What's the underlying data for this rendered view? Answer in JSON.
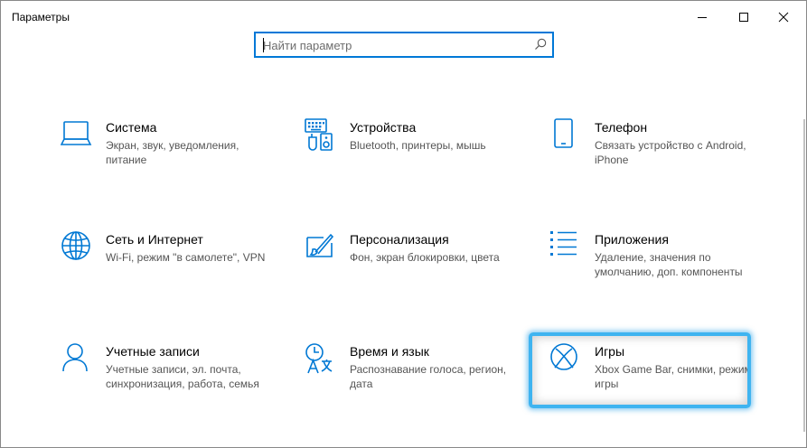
{
  "window": {
    "title": "Параметры"
  },
  "search": {
    "placeholder": "Найти параметр",
    "value": ""
  },
  "accent_color": "#0078d4",
  "highlight_color": "#3fb4f0",
  "tiles": [
    {
      "name": "Система",
      "desc": "Экран, звук, уведомления, питание",
      "icon": "laptop-icon"
    },
    {
      "name": "Устройства",
      "desc": "Bluetooth, принтеры, мышь",
      "icon": "devices-icon"
    },
    {
      "name": "Телефон",
      "desc": "Связать устройство с Android, iPhone",
      "icon": "phone-icon"
    },
    {
      "name": "Сеть и Интернет",
      "desc": "Wi-Fi, режим \"в самолете\", VPN",
      "icon": "globe-icon"
    },
    {
      "name": "Персонализация",
      "desc": "Фон, экран блокировки, цвета",
      "icon": "paint-icon"
    },
    {
      "name": "Приложения",
      "desc": "Удаление, значения по умолчанию, доп. компоненты",
      "icon": "apps-list-icon"
    },
    {
      "name": "Учетные записи",
      "desc": "Учетные записи, эл. почта, синхронизация, работа, семья",
      "icon": "person-icon"
    },
    {
      "name": "Время и язык",
      "desc": "Распознавание голоса, регион, дата",
      "icon": "time-language-icon"
    },
    {
      "name": "Игры",
      "desc": "Xbox Game Bar, снимки, режим игры",
      "icon": "xbox-icon"
    }
  ]
}
